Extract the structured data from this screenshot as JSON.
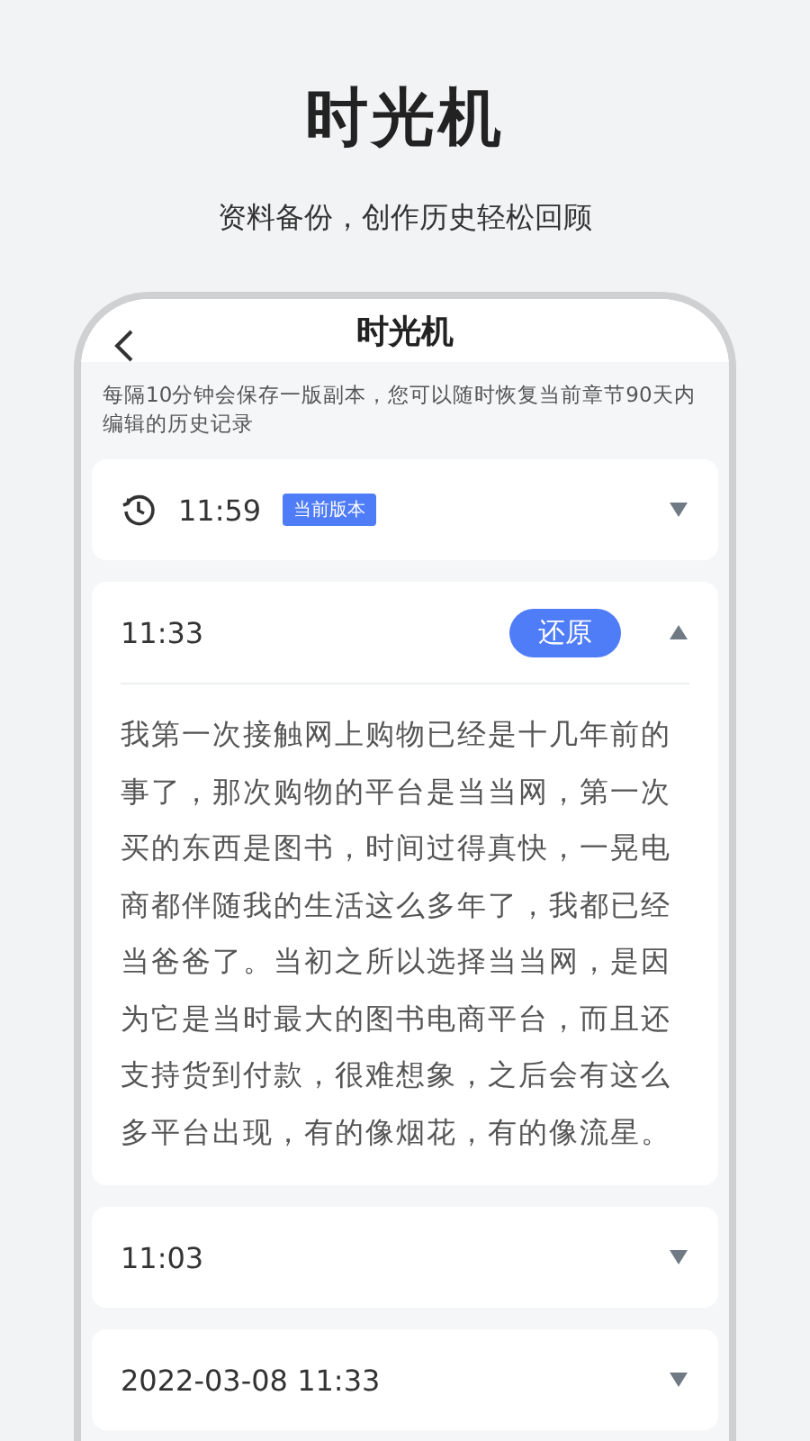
{
  "headline": {
    "title": "时光机",
    "subtitle": "资料备份，创作历史轻松回顾"
  },
  "screen": {
    "title": "时光机",
    "notice": "每隔10分钟会保存一版副本，您可以随时恢复当前章节90天内编辑的历史记录",
    "versions": [
      {
        "time": "11:59",
        "badge": "当前版本",
        "expanded": false
      },
      {
        "time": "11:33",
        "expanded": true,
        "action": "还原",
        "content": "我第一次接触网上购物已经是十几年前的事了，那次购物的平台是当当网，第一次买的东西是图书，时间过得真快，一晃电商都伴随我的生活这么多年了，我都已经当爸爸了。当初之所以选择当当网，是因为它是当时最大的图书电商平台，而且还支持货到付款，很难想象，之后会有这么多平台出现，有的像烟花，有的像流星。"
      },
      {
        "time": "11:03",
        "expanded": false
      },
      {
        "time": "2022-03-08 11:33",
        "expanded": false
      }
    ]
  }
}
